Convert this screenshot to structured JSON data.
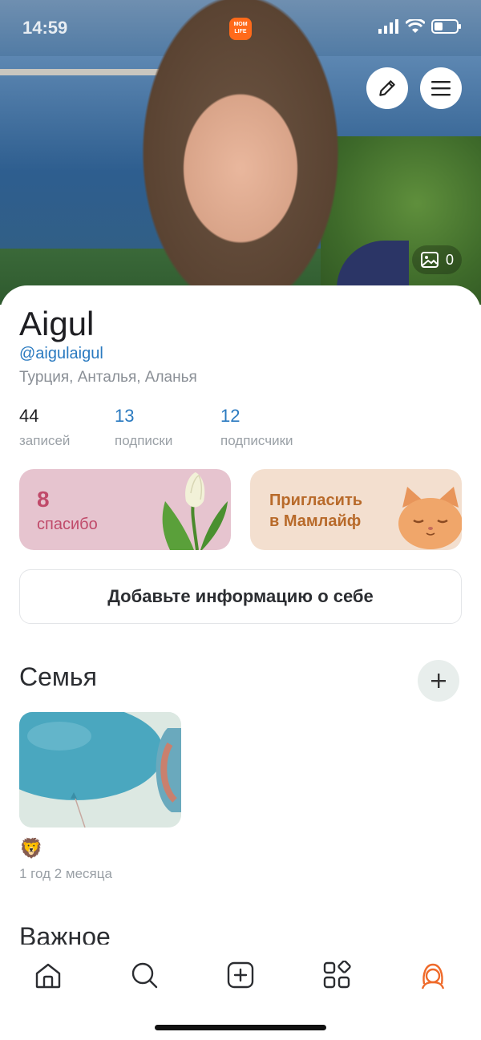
{
  "status": {
    "time": "14:59",
    "app_logo_text": "MOM LIFE"
  },
  "cover": {
    "photo_count": "0"
  },
  "profile": {
    "name": "Aigul",
    "handle": "@aigulaigul",
    "location": "Турция, Анталья, Аланья"
  },
  "stats": [
    {
      "value": "44",
      "label": "записей"
    },
    {
      "value": "13",
      "label": "подписки"
    },
    {
      "value": "12",
      "label": "подписчики"
    }
  ],
  "cards": {
    "thanks": {
      "count": "8",
      "label": "спасибо"
    },
    "invite": {
      "line1": "Пригласить",
      "line2": "в Мамлайф"
    }
  },
  "info_button": "Добавьте информацию о себе",
  "family": {
    "title": "Семья",
    "child": {
      "emoji": "🦁",
      "age": "1 год 2 месяца"
    }
  },
  "next_section_title": "Важное",
  "colors": {
    "accent": "#2a7ac0",
    "brand": "#ff6a1a",
    "thanks_text": "#c04a6a",
    "invite_text": "#b86a2a"
  },
  "icons": {
    "edit": "pencil-icon",
    "menu": "hamburger-menu-icon",
    "photos": "image-icon",
    "add": "plus-icon",
    "tabs": [
      "home-icon",
      "search-icon",
      "add-post-icon",
      "services-grid-icon",
      "profile-avatar-icon"
    ]
  }
}
